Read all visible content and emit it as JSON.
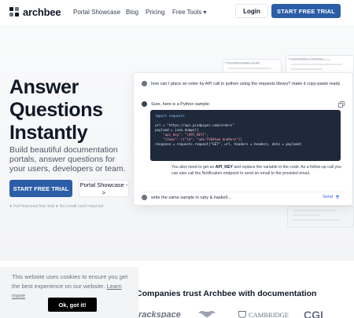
{
  "nav": {
    "logo_text": "archbee",
    "links": [
      "Portal Showcase",
      "Blog",
      "Pricing",
      "Free Tools ▾"
    ],
    "login": "Login",
    "cta": "START FREE TRIAL"
  },
  "hero": {
    "headline_lines": [
      "Answer",
      "Questions",
      "Instantly"
    ],
    "subheadline": "Build beautiful documentation portals, answer questions for your users, developers or team.",
    "cta_primary": "START FREE TRIAL",
    "cta_secondary": "Portal Showcase ->",
    "note": "● Full-featured free trial  ● No credit card required"
  },
  "background_cards": {
    "label_1": "Churchtechnology Center",
    "label_2": "Documentation Overview"
  },
  "chat": {
    "question": "how can I place an order by API call in python using the requests library? make it copy-paste ready",
    "answer_intro": "Sure, here is a Python sample:",
    "code_lines": [
      "import requests",
      "...",
      "url = \"https://api.pixdpiper.com/orders\"",
      "payload = json.dumps({",
      "    \"api_key\": \"{API_KEY}\",",
      "    \"items\": [{\"id\": \"udx-TVQ4hom_knd9ere\"}]",
      "response = requests.request(\"GET\", url, headers = headers, data = payload)"
    ],
    "para_prefix": "You also need to get an ",
    "para_bold": "API_KEY",
    "para_suffix": " and replace the variable in the code. As a follow-up call you can also call the Notification endpoint to send an email to the provided email.",
    "input_text": "write the same sample in ruby & haskell...",
    "send_label": "Send"
  },
  "cookie": {
    "text": "This website uses cookies to ensure you get the best experience on our website.",
    "link": "Learn more",
    "button": "Ok, got it!"
  },
  "trust": {
    "heading": "Companies trust Archbee with documentation",
    "brands": [
      "rackspace",
      "CAMBRIDGE",
      "CGI"
    ]
  },
  "colors": {
    "accent": "#2b5ea7",
    "code_bg": "#1e293b"
  }
}
